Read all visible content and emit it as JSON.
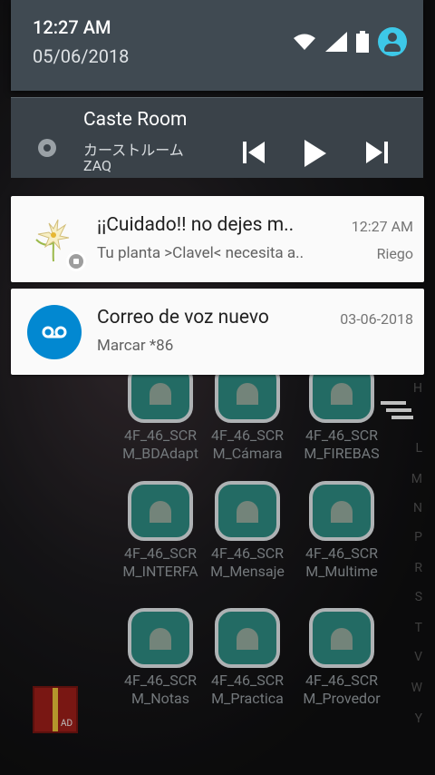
{
  "status": {
    "time": "12:27 AM",
    "date": "05/06/2018",
    "icons": [
      "wifi-icon",
      "signal-icon",
      "battery-icon",
      "account-icon"
    ]
  },
  "media": {
    "title": "Caste Room",
    "subtitle": "カーストルーム",
    "artist": "ZAQ",
    "controls": [
      "previous-icon",
      "play-icon",
      "next-icon"
    ]
  },
  "notifications": [
    {
      "title": "¡¡Cuidado!! no dejes m..",
      "text": "Tu planta >Clavel< necesita a..",
      "time": "12:27 AM",
      "extra": "Riego",
      "icon": "flower-icon"
    },
    {
      "title": "Correo de voz nuevo",
      "text": "Marcar *86",
      "time": "03-06-2018",
      "icon": "voicemail-icon"
    }
  ],
  "apps": [
    {
      "line1": "4F_46_SCR",
      "line2": "M_BDAdapt"
    },
    {
      "line1": "4F_46_SCR",
      "line2": "M_Cámara"
    },
    {
      "line1": "4F_46_SCR",
      "line2": "M_FIREBAS"
    },
    {
      "line1": "4F_46_SCR",
      "line2": "M_INTERFA"
    },
    {
      "line1": "4F_46_SCR",
      "line2": "M_Mensaje"
    },
    {
      "line1": "4F_46_SCR",
      "line2": "M_Multime"
    },
    {
      "line1": "4F_46_SCR",
      "line2": "M_Notas"
    },
    {
      "line1": "4F_46_SCR",
      "line2": "M_Practica"
    },
    {
      "line1": "4F_46_SCR",
      "line2": "M_Provedor"
    }
  ],
  "alphabet": [
    "H",
    "L",
    "M",
    "N",
    "P",
    "R",
    "S",
    "T",
    "V",
    "W",
    "Y"
  ],
  "gift_label": "AD"
}
